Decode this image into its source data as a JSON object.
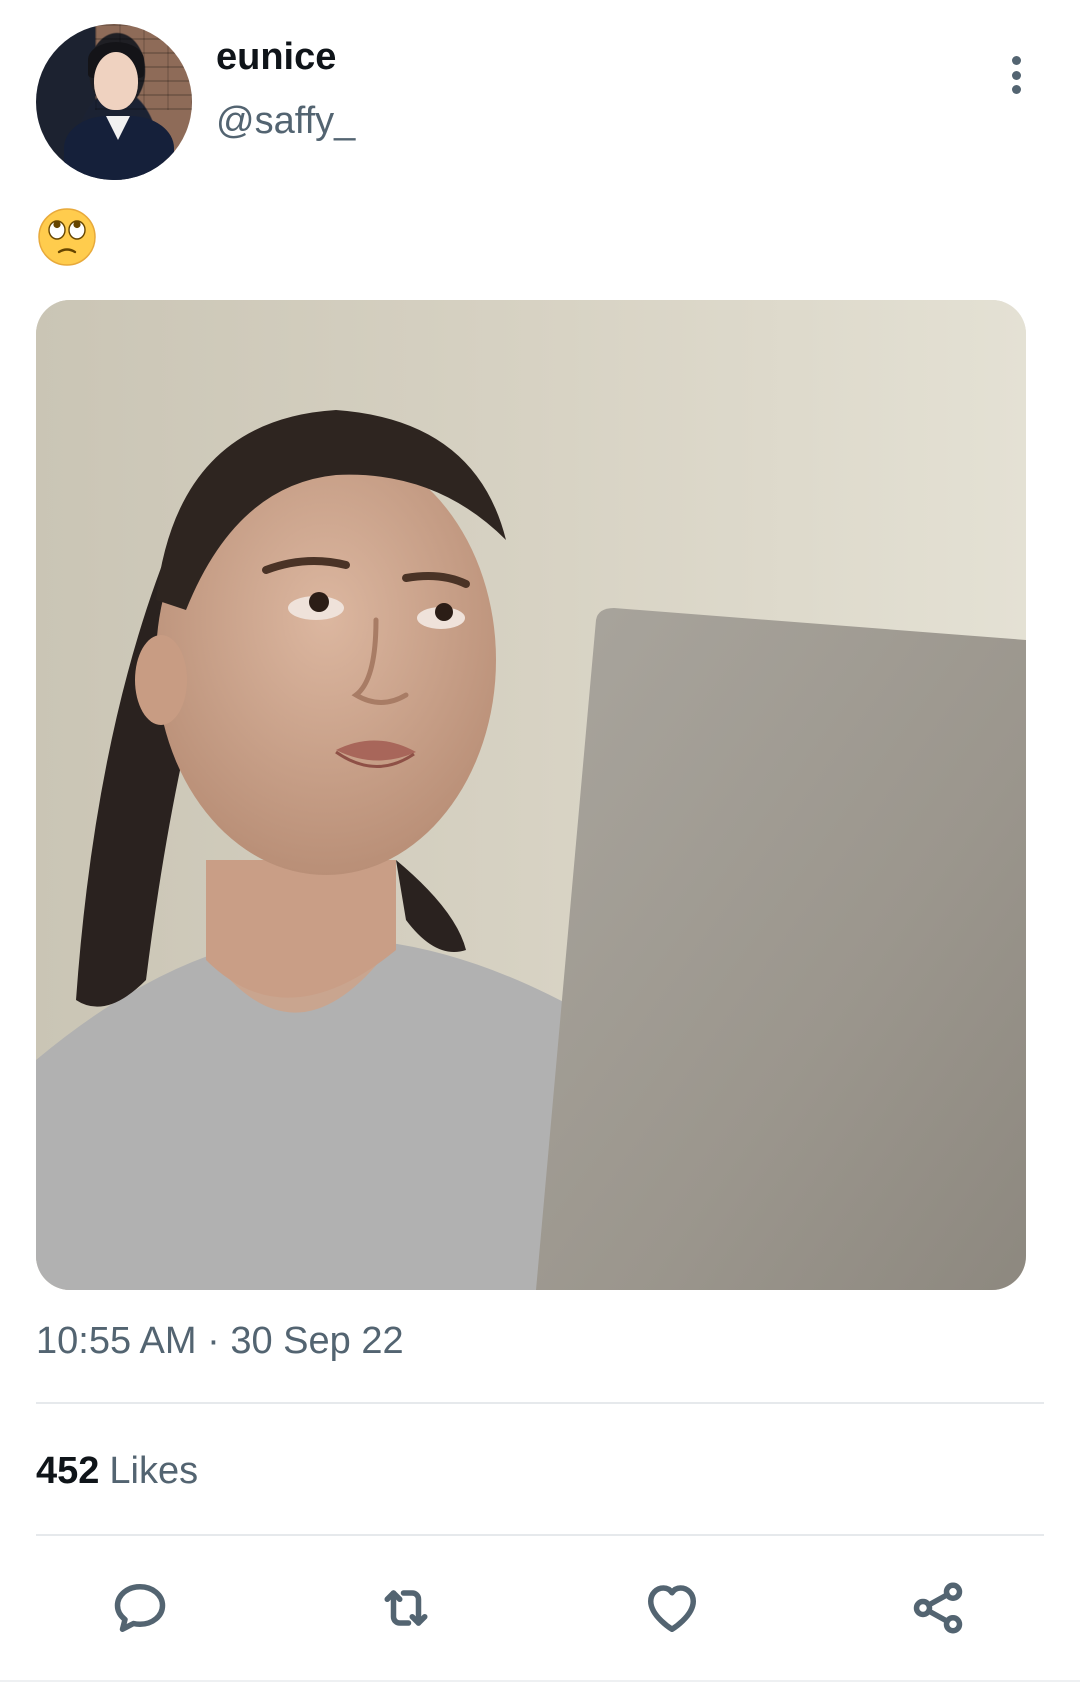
{
  "author": {
    "display_name": "eunice",
    "handle": "@saffy_"
  },
  "tweet": {
    "text_emoji": "face-with-rolling-eyes-emoji",
    "media_description": "photo",
    "timestamp": "10:55 AM · 30 Sep 22"
  },
  "stats": {
    "likes_count": "452",
    "likes_label": "Likes"
  },
  "actions": [
    {
      "name": "reply",
      "icon": "reply-icon"
    },
    {
      "name": "retweet",
      "icon": "retweet-icon"
    },
    {
      "name": "like",
      "icon": "heart-icon"
    },
    {
      "name": "share",
      "icon": "share-icon"
    }
  ],
  "colors": {
    "primary_text": "#0f1419",
    "secondary_text": "#536471",
    "divider": "#e6e9ec",
    "background": "#ffffff"
  }
}
